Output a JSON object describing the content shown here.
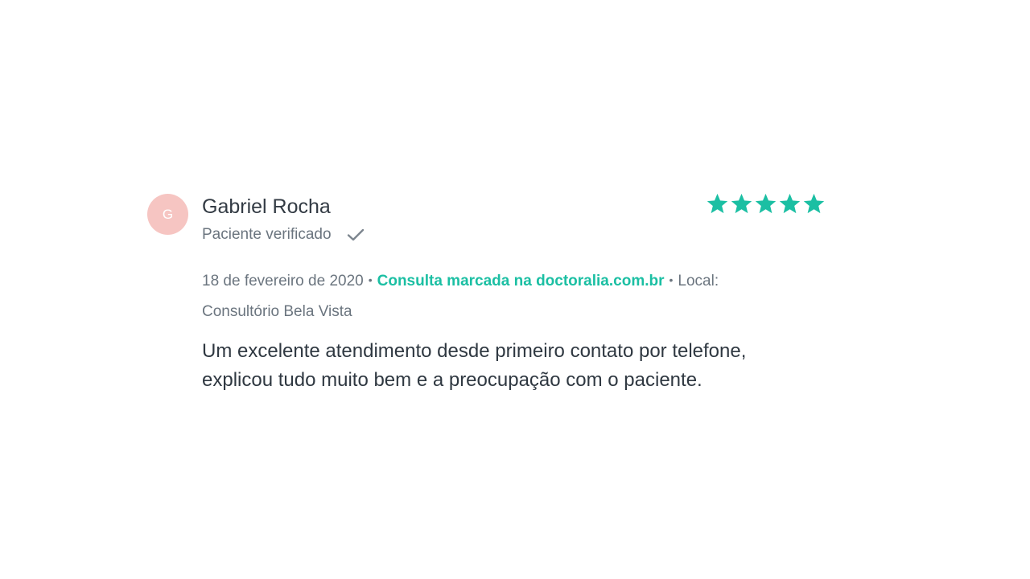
{
  "review": {
    "avatar_initial": "G",
    "author": "Gabriel Rocha",
    "verified_label": "Paciente verificado",
    "rating": 5,
    "rating_max": 5,
    "date": "18 de fevereiro de 2020",
    "separator": "•",
    "booked_via": "Consulta marcada na doctoralia.com.br",
    "location_label": "Local:",
    "location": "Consultório Bela Vista",
    "comment": "Um excelente atendimento desde primeiro contato por telefone, explicou tudo muito bem e a preocupação com o paciente."
  },
  "colors": {
    "accent": "#1bbfa3",
    "avatar_bg": "#f6c5c2",
    "muted_text": "#6b757f",
    "body_text": "#2f3841",
    "check": "#7d868f"
  },
  "icons": {
    "star": "star-icon",
    "check": "check-icon"
  }
}
